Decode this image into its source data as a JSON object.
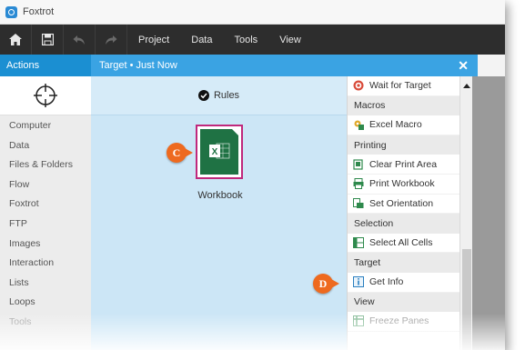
{
  "window": {
    "title": "Foxtrot"
  },
  "toolbar": {
    "menus": [
      "Project",
      "Data",
      "Tools",
      "View"
    ]
  },
  "header": {
    "actions_label": "Actions",
    "target_label": "Target  •  Just Now",
    "close_glyph": "✕"
  },
  "categories": [
    "Computer",
    "Data",
    "Files & Folders",
    "Flow",
    "Foxtrot",
    "FTP",
    "Images",
    "Interaction",
    "Lists",
    "Loops",
    "Tools"
  ],
  "main": {
    "rules_label": "Rules",
    "workbook_label": "Workbook",
    "excel_glyph": "X"
  },
  "callouts": {
    "c": "C",
    "d": "D"
  },
  "panel": {
    "wait_for_target": "Wait for Target",
    "macros_header": "Macros",
    "excel_macro": "Excel Macro",
    "printing_header": "Printing",
    "clear_print_area": "Clear Print Area",
    "print_workbook": "Print Workbook",
    "set_orientation": "Set Orientation",
    "selection_header": "Selection",
    "select_all_cells": "Select All Cells",
    "target_header": "Target",
    "get_info": "Get Info",
    "view_header": "View",
    "freeze_panes": "Freeze Panes"
  },
  "colors": {
    "accent_blue": "#1b8fd2",
    "header_blue": "#3aa3e3",
    "excel_green": "#1f7244",
    "callout_orange": "#ee6a1f",
    "highlight_magenta": "#c0287c"
  }
}
